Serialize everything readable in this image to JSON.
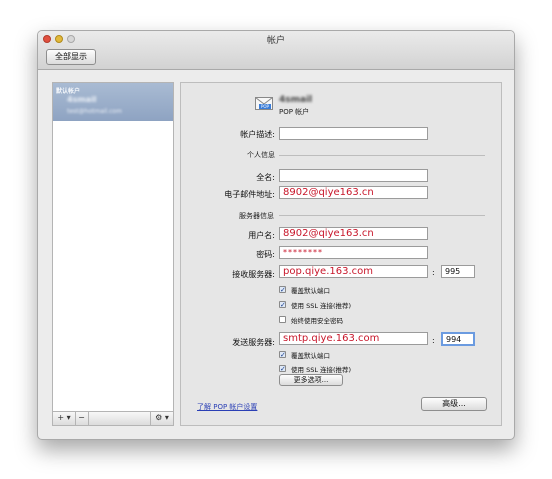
{
  "window": {
    "title": "帐户"
  },
  "toolbar": {
    "show_all_label": "全部显示"
  },
  "sidebar": {
    "group_label": "默认帐户",
    "selected_account_name": "4smail",
    "selected_account_email": "test@hotmail.com",
    "add_label": "+ ▾",
    "remove_label": "−",
    "gear_label": "⚙ ▾"
  },
  "account": {
    "name": "4smail",
    "type": "POP 帐户",
    "icon": "pop-mail-envelope-icon",
    "icon_badge": "POP"
  },
  "form": {
    "description_label": "帐户描述:",
    "description_value": "",
    "personal_section": "个人信息",
    "fullname_label": "全名:",
    "fullname_value": "",
    "email_label": "电子邮件地址:",
    "email_value": "8902@qiye163.cn",
    "server_section": "服务器信息",
    "username_label": "用户名:",
    "username_value": "8902@qiye163.cn",
    "password_label": "密码:",
    "password_value": "********",
    "incoming_label": "接收服务器:",
    "incoming_server": "pop.qiye.163.com",
    "incoming_port": "995",
    "incoming_override_default_port": "覆盖默认端口",
    "incoming_use_ssl": "使用 SSL 连接(推荐)",
    "incoming_always_secure_password": "始终使用安全密码",
    "outgoing_label": "发送服务器:",
    "outgoing_server": "smtp.qiye.163.com",
    "outgoing_port": "994",
    "outgoing_override_default_port": "覆盖默认端口",
    "outgoing_use_ssl": "使用 SSL 连接(推荐)",
    "more_options_label": "更多选项...",
    "port_separator": ":"
  },
  "checkboxes": {
    "incoming_override": true,
    "incoming_ssl": true,
    "incoming_secure_password": false,
    "outgoing_override": true,
    "outgoing_ssl": true
  },
  "footer": {
    "learn_link": "了解 POP 帐户设置",
    "advanced_label": "高级..."
  },
  "colors": {
    "accent_text": "#c8162a",
    "sidebar_selection": "#9cafc9",
    "link": "#2a3fb5"
  }
}
